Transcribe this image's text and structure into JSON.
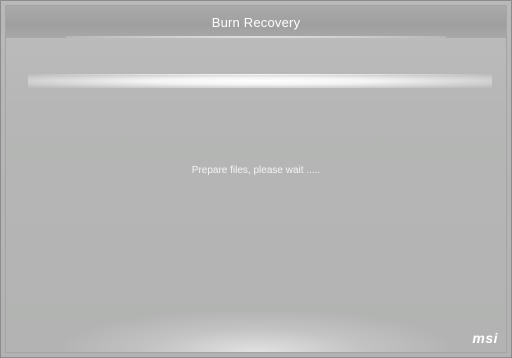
{
  "window": {
    "title": "Burn Recovery"
  },
  "main": {
    "status_text": "Prepare files, please wait ....."
  },
  "brand": {
    "logo_text": "msi"
  },
  "colors": {
    "background": "#b4b5b4",
    "title_text": "#ffffff",
    "status_text": "#f4f4f4"
  }
}
